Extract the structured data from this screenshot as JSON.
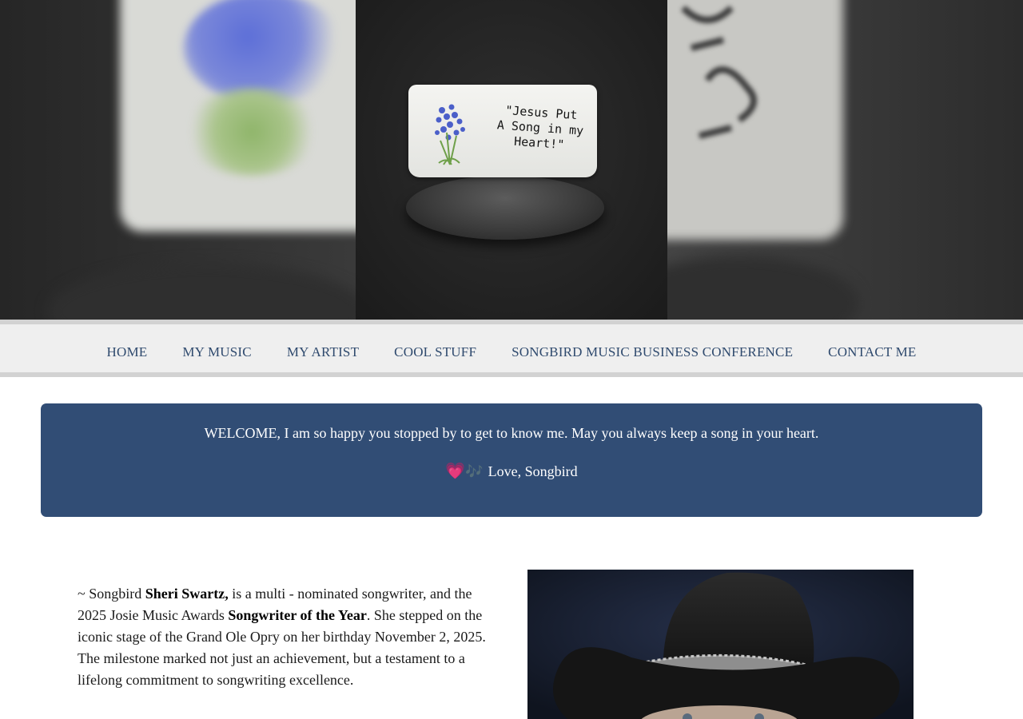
{
  "hero": {
    "plaque_text": "\"Jesus Put\nA Song in my\nHeart!\""
  },
  "nav": {
    "items": [
      {
        "label": "HOME"
      },
      {
        "label": "MY MUSIC"
      },
      {
        "label": "MY ARTIST"
      },
      {
        "label": "COOL STUFF"
      },
      {
        "label": "SONGBIRD MUSIC BUSINESS CONFERENCE"
      },
      {
        "label": "CONTACT ME"
      }
    ]
  },
  "welcome": {
    "message": "WELCOME,  I am so happy you stopped by to get to know me.   May you always keep a song in your heart.",
    "signature": "Love, Songbird",
    "heart_glyph": "💗",
    "note_glyph": "🎶"
  },
  "bio": {
    "part1": "~ Songbird ",
    "name": "Sheri Swartz,",
    "part2": "  is a multi - nominated songwriter, and the 2025 Josie Music Awards ",
    "award": "Songwriter of the Year",
    "part3": ". She stepped on the iconic stage of the Grand Ole Opry on her birthday November 2, 2025. The milestone marked not just an achievement, but a testament to a lifelong commitment to songwriting excellence."
  },
  "colors": {
    "nav_text": "#2f4a6e",
    "welcome_bg": "#314d75",
    "nav_bg": "#efefef"
  }
}
